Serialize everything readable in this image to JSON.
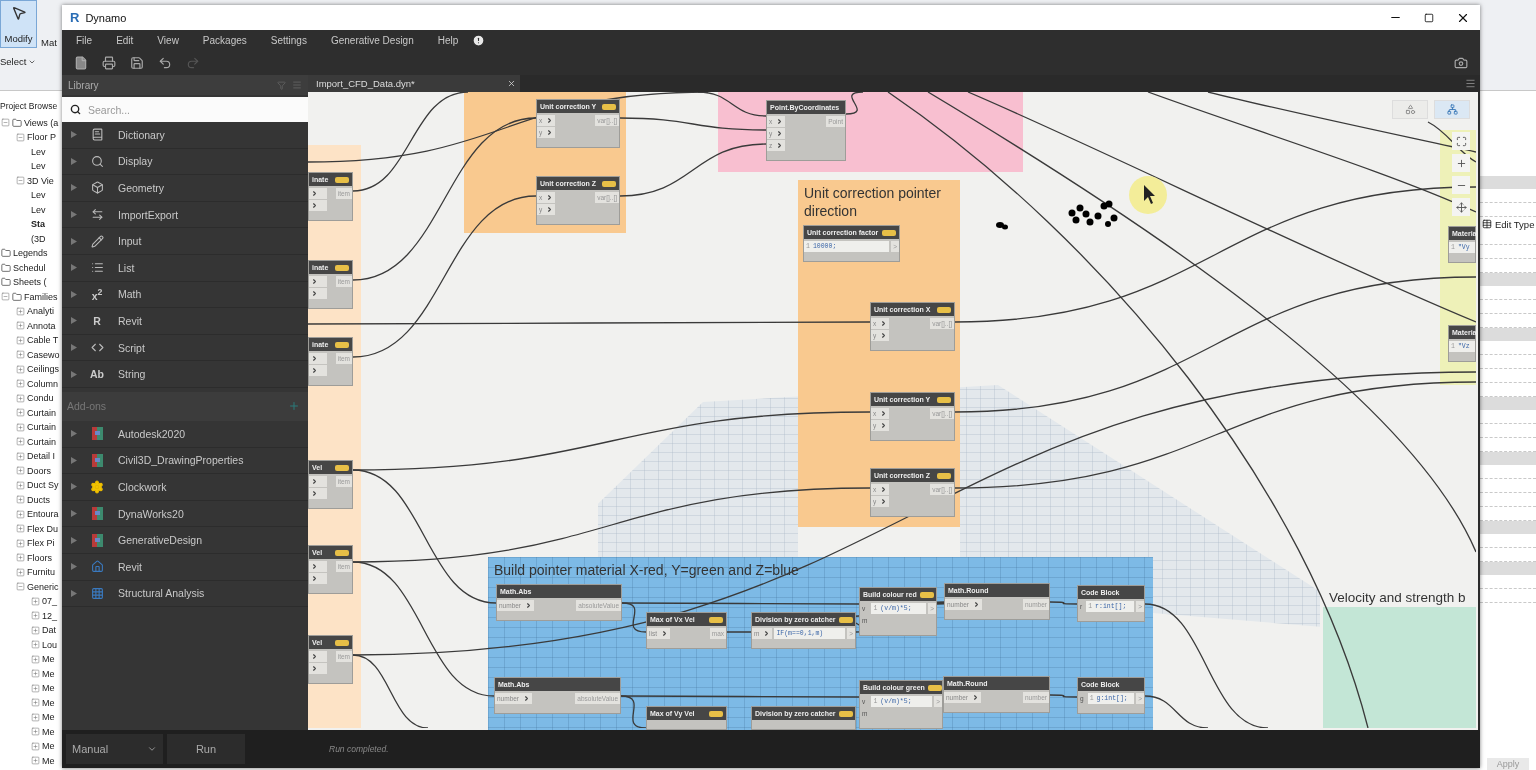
{
  "revit": {
    "ribbon": {
      "modify": "Modify",
      "material": "Mat",
      "select": "Select"
    },
    "browser": {
      "title": "Project Browse",
      "items": [
        {
          "label": "Views (a",
          "expanded": true,
          "children": [
            {
              "label": "Floor P",
              "expanded": true,
              "children": [
                {
                  "label": "Lev",
                  "active": false
                },
                {
                  "label": "Lev",
                  "active": false
                }
              ]
            },
            {
              "label": "3D Vie",
              "expanded": true,
              "children": [
                {
                  "label": "Lev",
                  "active": false
                },
                {
                  "label": "Lev",
                  "active": false
                },
                {
                  "label": "Sta",
                  "active": true
                },
                {
                  "label": "(3D",
                  "active": false
                }
              ]
            }
          ]
        },
        {
          "label": "Legends"
        },
        {
          "label": "Schedul"
        },
        {
          "label": "Sheets ("
        },
        {
          "label": "Families",
          "expanded": true,
          "children": [
            {
              "label": "Analyti",
              "expanded": false
            },
            {
              "label": "Annota",
              "expanded": false
            },
            {
              "label": "Cable T",
              "expanded": false
            },
            {
              "label": "Casewo",
              "expanded": false
            },
            {
              "label": "Ceilings",
              "expanded": false
            },
            {
              "label": "Column",
              "expanded": false
            },
            {
              "label": "Condu",
              "expanded": false
            },
            {
              "label": "Curtain",
              "expanded": false
            },
            {
              "label": "Curtain",
              "expanded": false
            },
            {
              "label": "Curtain",
              "expanded": false
            },
            {
              "label": "Detail I",
              "expanded": false
            },
            {
              "label": "Doors",
              "expanded": false
            },
            {
              "label": "Duct Sy",
              "expanded": false
            },
            {
              "label": "Ducts",
              "expanded": false
            },
            {
              "label": "Entoura",
              "expanded": false
            },
            {
              "label": "Flex Du",
              "expanded": false
            },
            {
              "label": "Flex Pi",
              "expanded": false
            },
            {
              "label": "Floors",
              "expanded": false
            },
            {
              "label": "Furnitu",
              "expanded": false
            },
            {
              "label": "Generic",
              "expanded": true,
              "children": [
                {
                  "label": "07_",
                  "expanded": false
                },
                {
                  "label": "12_",
                  "expanded": false
                },
                {
                  "label": "Dat",
                  "expanded": false
                },
                {
                  "label": "Lou",
                  "expanded": false
                },
                {
                  "label": "Me",
                  "expanded": false
                },
                {
                  "label": "Me",
                  "expanded": false
                },
                {
                  "label": "Me",
                  "expanded": false
                },
                {
                  "label": "Me",
                  "expanded": false
                },
                {
                  "label": "Me",
                  "expanded": false
                },
                {
                  "label": "Me",
                  "expanded": false
                },
                {
                  "label": "Me",
                  "expanded": false
                },
                {
                  "label": "Me",
                  "expanded": false
                }
              ]
            }
          ]
        }
      ]
    },
    "properties": {
      "edit_type": "Edit Type",
      "apply": "Apply"
    }
  },
  "window": {
    "logo": "R",
    "title": "Dynamo"
  },
  "menu": [
    "File",
    "Edit",
    "View",
    "Packages",
    "Settings",
    "Generative Design",
    "Help"
  ],
  "library": {
    "title": "Library",
    "search": {
      "placeholder": "Search..."
    },
    "categories": [
      {
        "label": "Dictionary",
        "kind": "icon"
      },
      {
        "label": "Display",
        "kind": "icon"
      },
      {
        "label": "Geometry",
        "kind": "icon"
      },
      {
        "label": "ImportExport",
        "kind": "icon"
      },
      {
        "label": "Input",
        "kind": "icon"
      },
      {
        "label": "List",
        "kind": "icon"
      },
      {
        "label": "Math",
        "kind": "glyph",
        "glyph": "x$^{2}$"
      },
      {
        "label": "Revit",
        "kind": "glyph",
        "glyph": "R"
      },
      {
        "label": "Script",
        "kind": "icon"
      },
      {
        "label": "String",
        "kind": "glyph",
        "glyph": "Ab"
      }
    ],
    "addons_title": "Add-ons",
    "addons": [
      {
        "label": "Autodesk2020",
        "kind": "package"
      },
      {
        "label": "Civil3D_DrawingProperties",
        "kind": "package"
      },
      {
        "label": "Clockwork",
        "kind": "gear"
      },
      {
        "label": "DynaWorks20",
        "kind": "package"
      },
      {
        "label": "GenerativeDesign",
        "kind": "package"
      },
      {
        "label": "Revit",
        "kind": "house"
      },
      {
        "label": "Structural Analysis",
        "kind": "grid"
      }
    ]
  },
  "tabs": [
    {
      "label": "Import_CFD_Data.dyn*",
      "selected": true
    }
  ],
  "view_modes": [
    {
      "selected": false
    },
    {
      "selected": true
    }
  ],
  "groups": [
    {
      "color": "#fde3c6"
    },
    {
      "color": "#f9c98f"
    },
    {
      "color": "#f8bfd0"
    },
    {
      "title": "Unit correction pointer direction",
      "color": "#f9c98f"
    },
    {
      "title": "Build pointer material X-red, Y=green and Z=blue",
      "color": "#7dbae6"
    },
    {
      "title": "Velocity and strength b",
      "color": "#c3e6d6"
    },
    {
      "color": "#eef1b8"
    }
  ],
  "nodes": [
    {
      "title": "inate",
      "renamed": true,
      "inputs": [
        {
          "kind": "port"
        },
        {
          "kind": "port"
        }
      ],
      "outputs": [
        "item"
      ]
    },
    {
      "title": "inate",
      "renamed": true,
      "inputs": [
        {
          "kind": "port"
        },
        {
          "kind": "port"
        }
      ],
      "outputs": [
        "item"
      ]
    },
    {
      "title": "inate",
      "renamed": true,
      "inputs": [
        {
          "kind": "port"
        },
        {
          "kind": "port"
        }
      ],
      "outputs": [
        "item"
      ]
    },
    {
      "title": "Vel",
      "renamed": true,
      "inputs": [
        {
          "kind": "port"
        },
        {
          "kind": "port"
        }
      ],
      "outputs": [
        "item"
      ]
    },
    {
      "title": "Vel",
      "renamed": true,
      "inputs": [
        {
          "kind": "port"
        },
        {
          "kind": "port"
        }
      ],
      "outputs": [
        "item"
      ]
    },
    {
      "title": "Vel",
      "renamed": true,
      "inputs": [
        {
          "kind": "port"
        },
        {
          "kind": "port"
        }
      ],
      "outputs": [
        "item"
      ]
    },
    {
      "title": "Unit correction Y",
      "renamed": true,
      "inputs": [
        {
          "kind": "port",
          "label": "x"
        },
        {
          "kind": "port",
          "label": "y"
        }
      ],
      "outputs": [
        "var[]..[]"
      ]
    },
    {
      "title": "Unit correction Z",
      "renamed": true,
      "inputs": [
        {
          "kind": "port",
          "label": "x"
        },
        {
          "kind": "port",
          "label": "y"
        }
      ],
      "outputs": [
        "var[]..[]"
      ]
    },
    {
      "title": "Point.ByCoordinates",
      "renamed": false,
      "inputs": [
        {
          "kind": "port",
          "label": "x"
        },
        {
          "kind": "port",
          "label": "y"
        },
        {
          "kind": "port",
          "label": "z"
        }
      ],
      "outputs": [
        "Point"
      ]
    },
    {
      "title": "Unit correction factor",
      "renamed": true,
      "code": {
        "line": "1",
        "text": "10000;"
      },
      "outputs": [
        ">"
      ]
    },
    {
      "title": "Unit correction X",
      "renamed": true,
      "inputs": [
        {
          "kind": "port",
          "label": "x"
        },
        {
          "kind": "port",
          "label": "y"
        }
      ],
      "outputs": [
        "var[]..[]"
      ]
    },
    {
      "title": "Unit correction Y",
      "renamed": true,
      "inputs": [
        {
          "kind": "port",
          "label": "x"
        },
        {
          "kind": "port",
          "label": "y"
        }
      ],
      "outputs": [
        "var[]..[]"
      ]
    },
    {
      "title": "Unit correction Z",
      "renamed": true,
      "inputs": [
        {
          "kind": "port",
          "label": "x"
        },
        {
          "kind": "port",
          "label": "y"
        }
      ],
      "outputs": [
        "var[]..[]"
      ]
    },
    {
      "title": "Math.Abs",
      "renamed": false,
      "inputs": [
        {
          "kind": "port",
          "label": "number"
        }
      ],
      "outputs": [
        "absoluteValue"
      ]
    },
    {
      "title": "Max of Vx Vel",
      "renamed": true,
      "inputs": [
        {
          "kind": "port",
          "label": "list"
        }
      ],
      "outputs": [
        "max"
      ]
    },
    {
      "title": "Division by zero catcher",
      "renamed": true,
      "inputs": [
        {
          "kind": "port",
          "label": "m"
        }
      ],
      "code": {
        "text": "IF(m==0,1,m)"
      },
      "outputs": [
        ">"
      ]
    },
    {
      "title": "Build colour red",
      "renamed": true,
      "inputs": [
        {
          "kind": "plain",
          "label": "v"
        },
        {
          "kind": "plain",
          "label": "m"
        }
      ],
      "code": {
        "line": "1",
        "text": "(v/m)*5;"
      },
      "outputs": [
        ">"
      ]
    },
    {
      "title": "Math.Round",
      "renamed": false,
      "inputs": [
        {
          "kind": "port",
          "label": "number"
        }
      ],
      "outputs": [
        "number"
      ]
    },
    {
      "title": "Code Block",
      "renamed": false,
      "inputs": [
        {
          "kind": "plain",
          "label": "r"
        }
      ],
      "code": {
        "line": "1",
        "text": "r:int[];"
      },
      "outputs": [
        ">"
      ]
    },
    {
      "title": "Math.Abs",
      "renamed": false,
      "inputs": [
        {
          "kind": "port",
          "label": "number"
        }
      ],
      "outputs": [
        "absoluteValue"
      ]
    },
    {
      "title": "Max of Vy Vel",
      "renamed": true
    },
    {
      "title": "Division by zero catcher",
      "renamed": true
    },
    {
      "title": "Build colour green",
      "renamed": true,
      "inputs": [
        {
          "kind": "plain",
          "label": "v"
        },
        {
          "kind": "plain",
          "label": "m"
        }
      ],
      "code": {
        "line": "1",
        "text": "(v/m)*5;"
      },
      "outputs": [
        ">"
      ]
    },
    {
      "title": "Math.Round",
      "renamed": false,
      "inputs": [
        {
          "kind": "port",
          "label": "number"
        }
      ],
      "outputs": [
        "number"
      ]
    },
    {
      "title": "Code Block",
      "renamed": false,
      "inputs": [
        {
          "kind": "plain",
          "label": "g"
        }
      ],
      "code": {
        "line": "1",
        "text": "g:int[];"
      },
      "outputs": [
        ">"
      ]
    },
    {
      "title": "Materia",
      "renamed": false,
      "code": {
        "line": "1",
        "text": "\"Vy"
      }
    },
    {
      "title": "Materia",
      "renamed": false,
      "code": {
        "line": "1",
        "text": "\"Vz"
      }
    }
  ],
  "run": {
    "mode": "Manual",
    "button": "Run",
    "status": "Run completed."
  }
}
